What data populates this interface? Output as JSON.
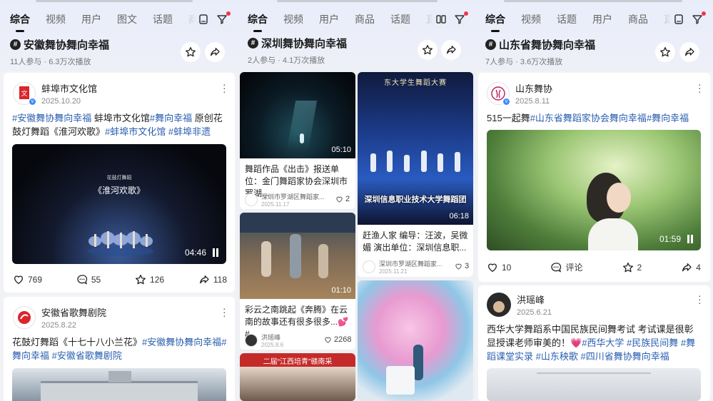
{
  "panels": [
    {
      "tabs": [
        "综合",
        "视频",
        "用户",
        "图文",
        "话题",
        "商品"
      ],
      "topic": {
        "title": "安徽舞协舞向幸福",
        "meta": "11人参与 · 6.3万次播放"
      },
      "post1": {
        "author": "蚌埠市文化馆",
        "date": "2025.10.20",
        "text_parts": [
          "#安徽舞协舞向幸福",
          " 蚌埠市文化馆",
          "#舞向幸福",
          " 原创花鼓灯舞蹈《淮河欢歌》",
          "#蚌埠市文化馆",
          " ",
          "#蚌埠非遗"
        ],
        "video_small": "花鼓灯舞蹈",
        "video_title": "《淮河欢歌》",
        "duration": "04:46",
        "likes": "769",
        "comments": "55",
        "stars": "126",
        "shares": "118"
      },
      "post2": {
        "author": "安徽省歌舞剧院",
        "date": "2025.8.22",
        "text_parts": [
          "花鼓灯舞蹈《十七十八小兰花》",
          "#安徽舞协舞向幸福",
          "#舞向幸福",
          " ",
          "#安徽省歌舞剧院"
        ]
      }
    },
    {
      "tabs": [
        "综合",
        "视频",
        "用户",
        "商品",
        "话题",
        "直播"
      ],
      "topic": {
        "title": "深圳舞协舞向幸福",
        "meta": "2人参与 · 4.1万次播放"
      },
      "items": [
        {
          "duration": "05:10",
          "caption": "舞蹈作品《出击》报送单位：金门舞蹈家协会深圳市罗湖...",
          "author": "深圳市罗湖区舞蹈家...",
          "date": "2025.11.17",
          "likes": "2"
        },
        {
          "duration": "06:18",
          "banner": "东大学生舞蹈大赛",
          "overlay": "深圳信息职业技术大学舞蹈团",
          "caption": "赶渔人家 编导：汪波，吴微媚 演出单位：深圳信息职...",
          "author": "深圳市罗湖区舞蹈家...",
          "date": "2025.11.21",
          "likes": "3"
        },
        {
          "duration": "01:10",
          "caption": "彩云之南跳起《奔腾》在云南的故事还有很多很多...💕#...",
          "author": "洪瑶峰",
          "date": "2025.8.6",
          "likes": "2268"
        },
        {
          "banner": "二届“江西培青”赣南采",
          "overlay": ""
        }
      ]
    },
    {
      "tabs": [
        "综合",
        "视频",
        "话题",
        "用户",
        "商品",
        "直播"
      ],
      "topic": {
        "title": "山东省舞协舞向幸福",
        "meta": "7人参与 · 3.6万次播放"
      },
      "post1": {
        "author": "山东舞协",
        "date": "2025.8.11",
        "text_parts": [
          "515一起舞",
          "#山东省舞蹈家协会舞向幸福",
          "#舞向幸福"
        ],
        "duration": "01:59",
        "likes": "10",
        "comments": "评论",
        "stars": "2",
        "shares": "4"
      },
      "post2": {
        "author": "洪瑶峰",
        "date": "2025.6.21",
        "text_parts": [
          "西华大学舞蹈系中国民族民间舞考试 考试课是很彰显授课老师审美的！💗",
          "#西华大学",
          " ",
          "#民族民间舞",
          " ",
          "#舞蹈课堂实录",
          " ",
          "#山东秧歌",
          " ",
          "#四川省舞协舞向幸福"
        ]
      }
    }
  ],
  "colors": {
    "tag": "#2b5fb0",
    "bg": "#f1f2f6",
    "badge": "#3d8bff",
    "reddot": "#f5344b"
  }
}
